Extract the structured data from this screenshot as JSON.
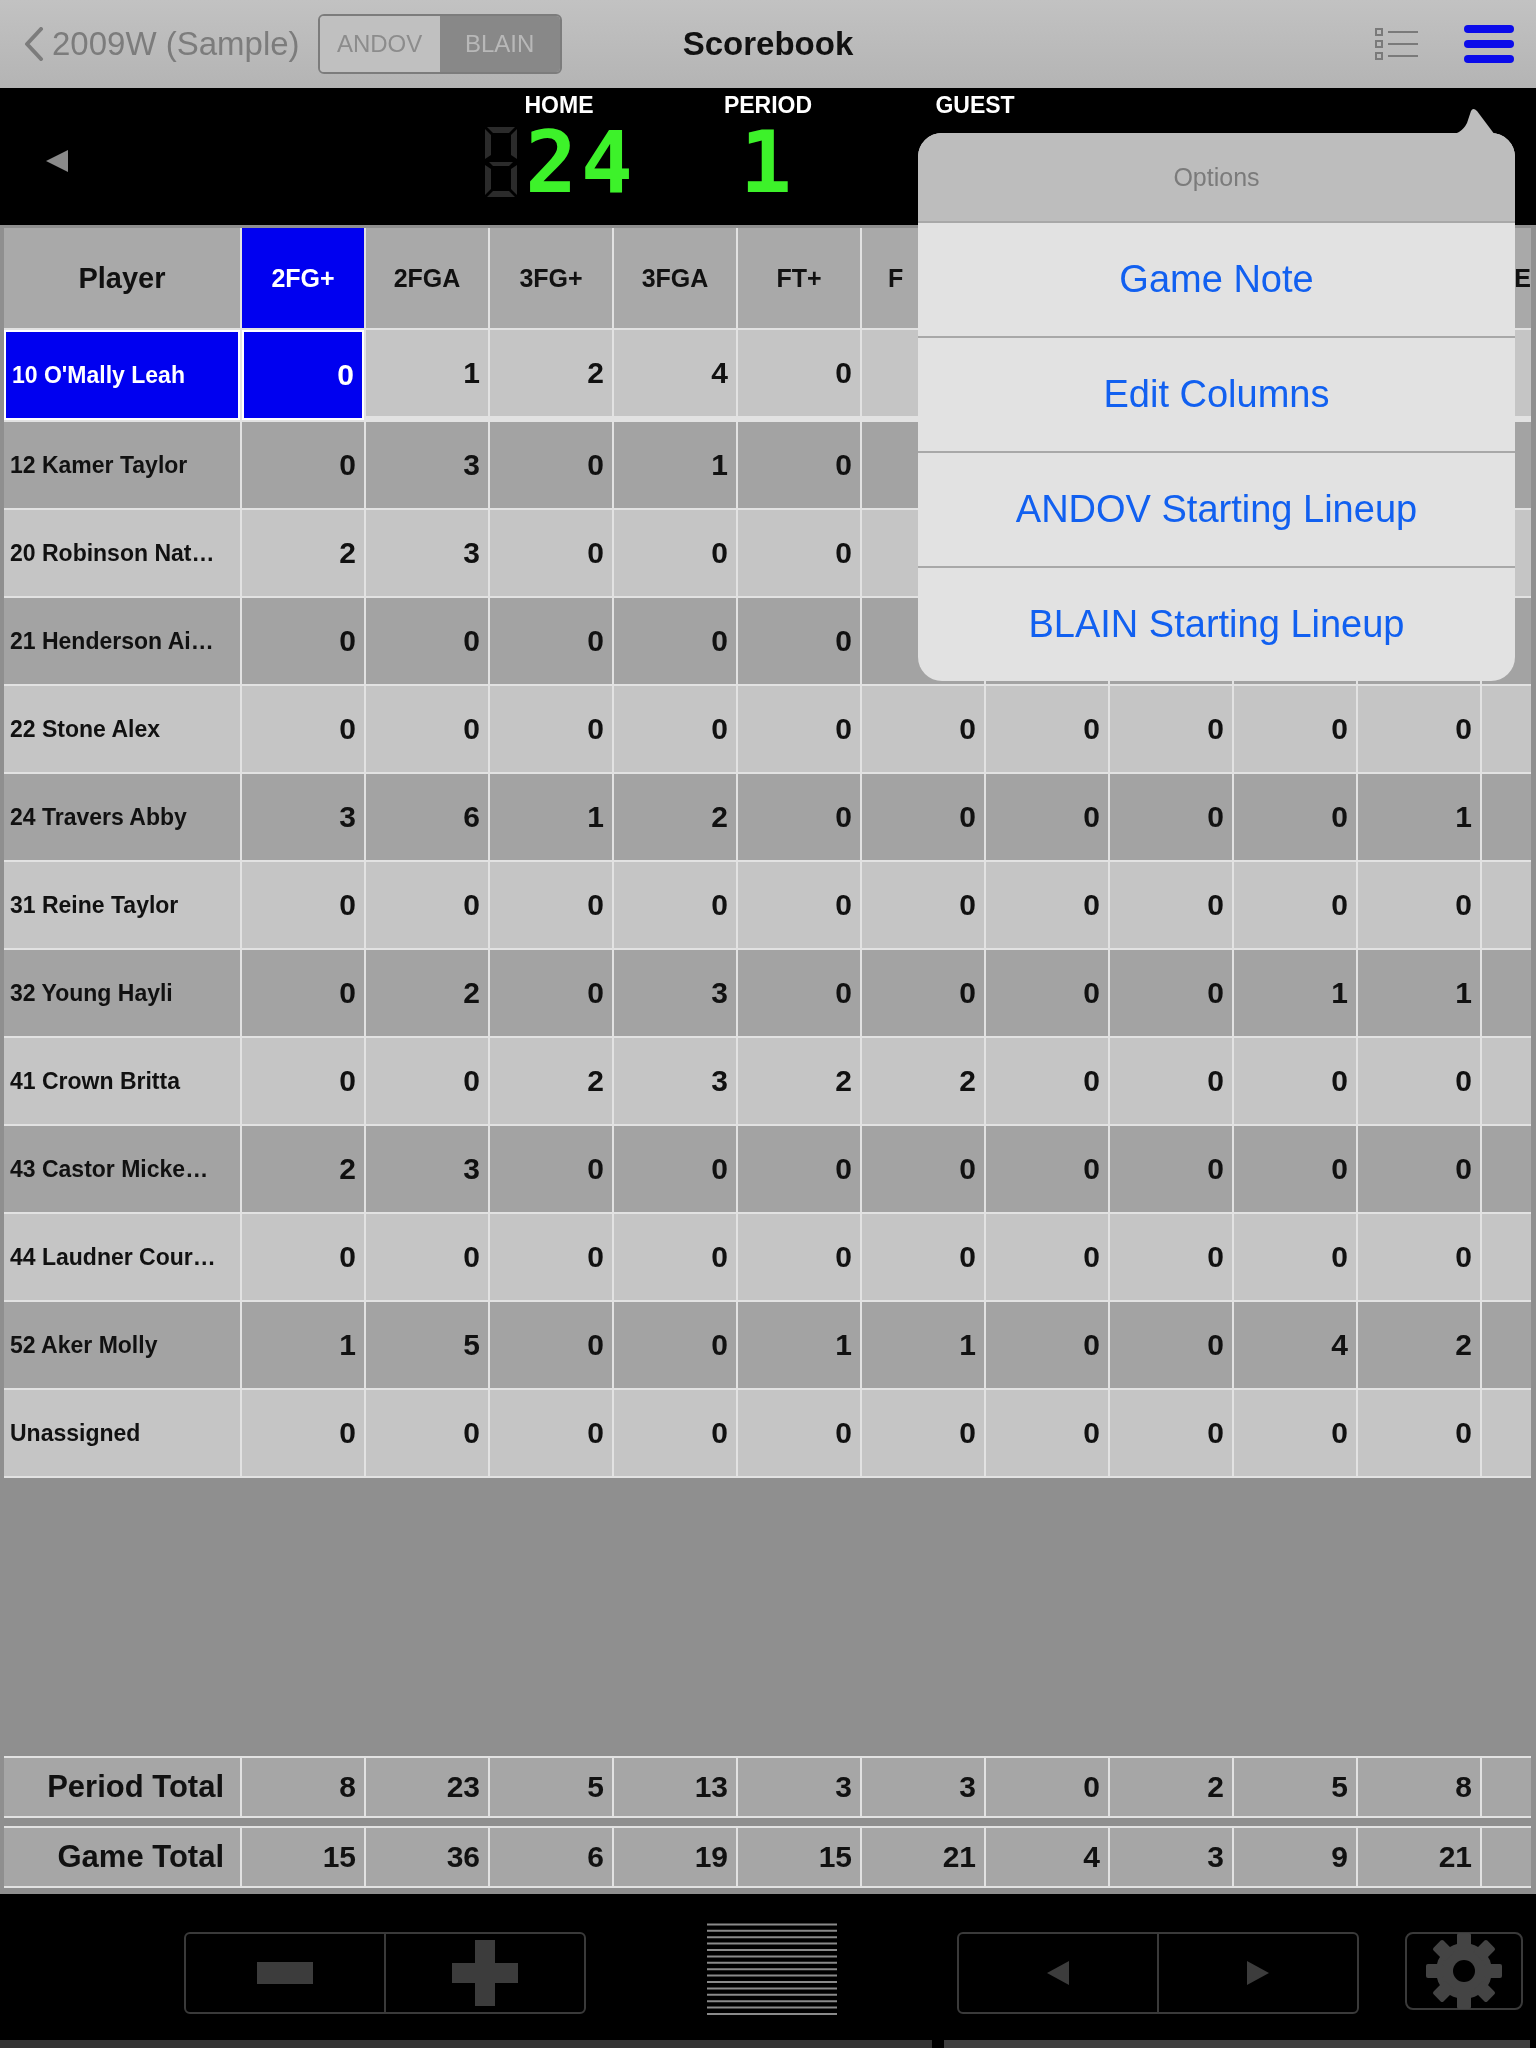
{
  "top_bar": {
    "back_label": "2009W (Sample)",
    "teams": [
      {
        "label": "ANDOV",
        "selected": false
      },
      {
        "label": "BLAIN",
        "selected": true
      }
    ],
    "title": "Scorebook"
  },
  "scoreboard": {
    "home_label": "HOME",
    "home_score": "24",
    "period_label": "PERIOD",
    "period": "1",
    "guest_label": "GUEST"
  },
  "table": {
    "player_heading": "Player",
    "columns": [
      {
        "label": "2FG+",
        "selected": true
      },
      {
        "label": "2FGA",
        "selected": false
      },
      {
        "label": "3FG+",
        "selected": false
      },
      {
        "label": "3FGA",
        "selected": false
      },
      {
        "label": "FT+",
        "selected": false
      },
      {
        "label": "F",
        "selected": false
      }
    ],
    "edge_column_heading": "E",
    "rows": [
      {
        "player": "10 O'Mally Leah",
        "selected": true,
        "values": [
          "0",
          "1",
          "2",
          "4",
          "0"
        ]
      },
      {
        "player": "12 Kamer Taylor",
        "selected": false,
        "values": [
          "0",
          "3",
          "0",
          "1",
          "0"
        ]
      },
      {
        "player": "20 Robinson Nat…",
        "selected": false,
        "values": [
          "2",
          "3",
          "0",
          "0",
          "0"
        ]
      },
      {
        "player": "21 Henderson Ai…",
        "selected": false,
        "values": [
          "0",
          "0",
          "0",
          "0",
          "0"
        ]
      },
      {
        "player": "22 Stone Alex",
        "selected": false,
        "values": [
          "0",
          "0",
          "0",
          "0",
          "0",
          "0",
          "0",
          "0",
          "0",
          "0"
        ]
      },
      {
        "player": "24 Travers Abby",
        "selected": false,
        "values": [
          "3",
          "6",
          "1",
          "2",
          "0",
          "0",
          "0",
          "0",
          "0",
          "1"
        ]
      },
      {
        "player": "31 Reine Taylor",
        "selected": false,
        "values": [
          "0",
          "0",
          "0",
          "0",
          "0",
          "0",
          "0",
          "0",
          "0",
          "0"
        ]
      },
      {
        "player": "32 Young Hayli",
        "selected": false,
        "values": [
          "0",
          "2",
          "0",
          "3",
          "0",
          "0",
          "0",
          "0",
          "1",
          "1"
        ]
      },
      {
        "player": "41 Crown Britta",
        "selected": false,
        "values": [
          "0",
          "0",
          "2",
          "3",
          "2",
          "2",
          "0",
          "0",
          "0",
          "0"
        ]
      },
      {
        "player": "43 Castor Micke…",
        "selected": false,
        "values": [
          "2",
          "3",
          "0",
          "0",
          "0",
          "0",
          "0",
          "0",
          "0",
          "0"
        ]
      },
      {
        "player": "44 Laudner Cour…",
        "selected": false,
        "values": [
          "0",
          "0",
          "0",
          "0",
          "0",
          "0",
          "0",
          "0",
          "0",
          "0"
        ]
      },
      {
        "player": "52 Aker Molly",
        "selected": false,
        "values": [
          "1",
          "5",
          "0",
          "0",
          "1",
          "1",
          "0",
          "0",
          "4",
          "2"
        ]
      },
      {
        "player": "Unassigned",
        "selected": false,
        "values": [
          "0",
          "0",
          "0",
          "0",
          "0",
          "0",
          "0",
          "0",
          "0",
          "0"
        ]
      }
    ],
    "totals": [
      {
        "label": "Period Total",
        "values": [
          "8",
          "23",
          "5",
          "13",
          "3",
          "3",
          "0",
          "2",
          "5",
          "8"
        ]
      },
      {
        "label": "Game Total",
        "values": [
          "15",
          "36",
          "6",
          "19",
          "15",
          "21",
          "4",
          "3",
          "9",
          "21"
        ]
      }
    ]
  },
  "options_popover": {
    "title": "Options",
    "items": [
      "Game Note",
      "Edit Columns",
      "ANDOV Starting Lineup",
      "BLAIN Starting Lineup"
    ]
  }
}
